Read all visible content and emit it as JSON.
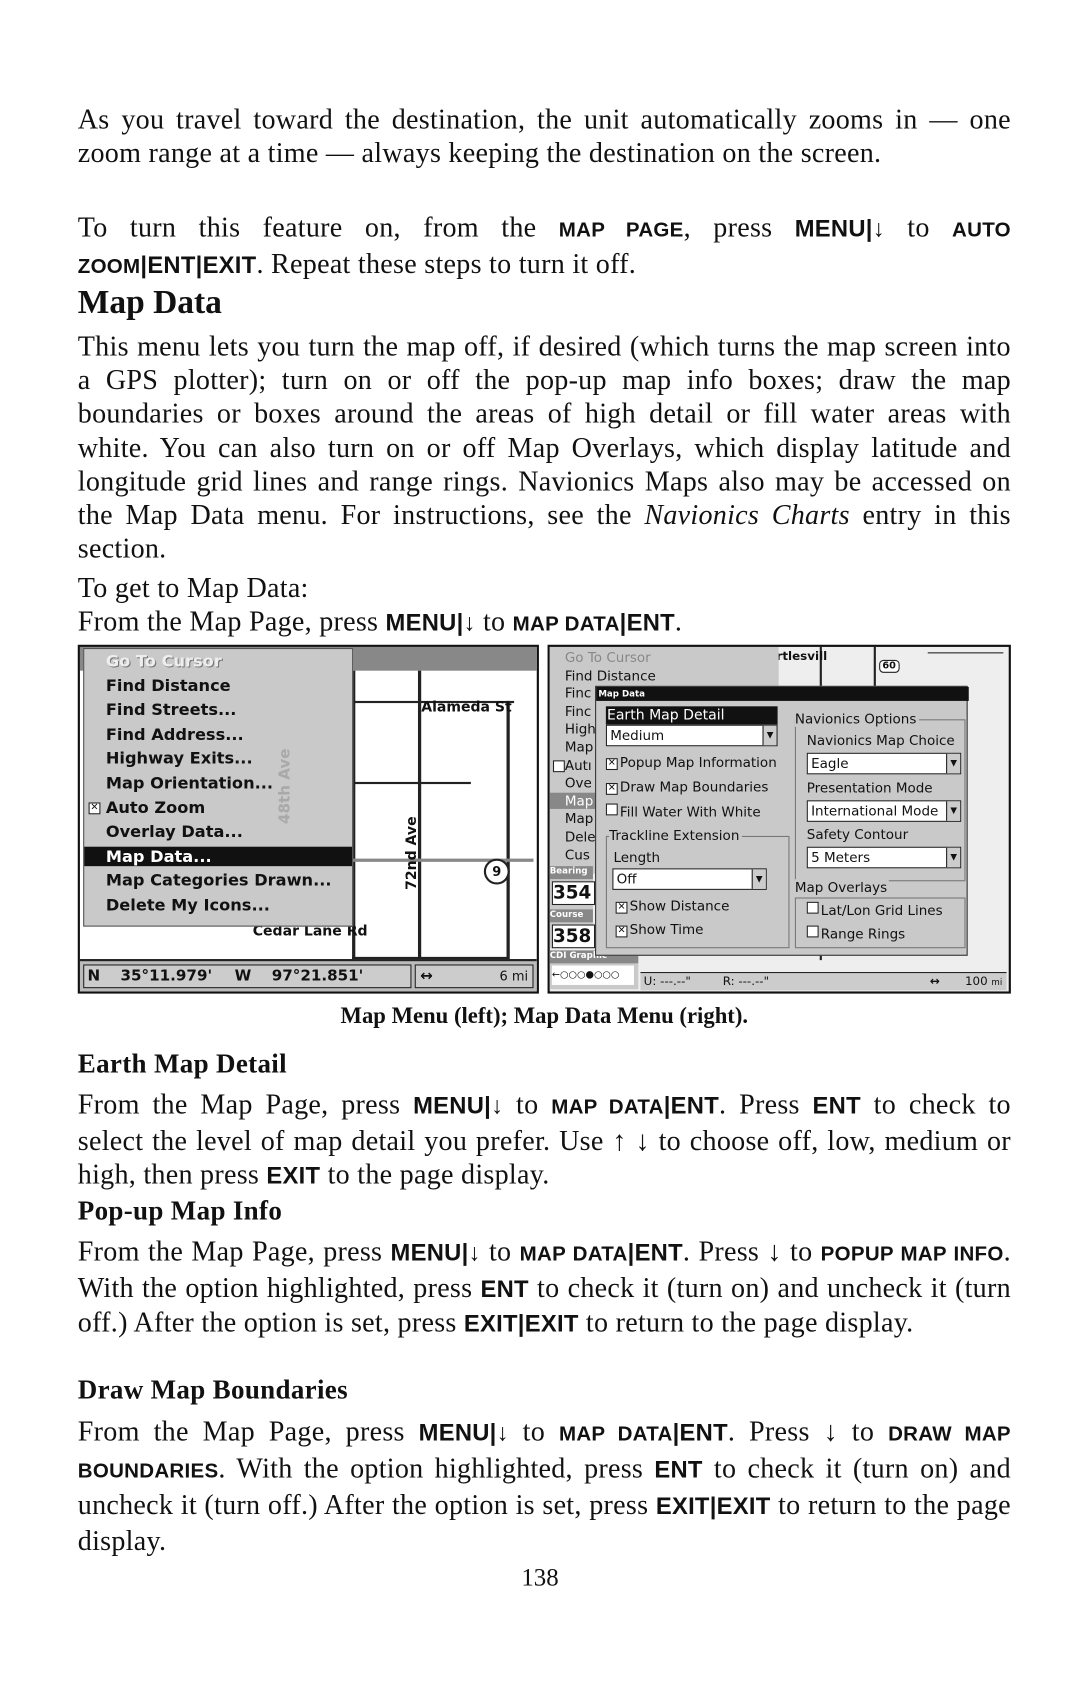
{
  "paragraphs": {
    "p1": [
      {
        "t": "As you travel toward the destination, the unit automatically zooms in — one zoom range at a time — always keeping the destination on the screen."
      }
    ],
    "p2": [
      {
        "t": "To turn this feature on, from the "
      },
      {
        "t": "Map Page",
        "s": "sc"
      },
      {
        "t": ", press "
      },
      {
        "t": "MENU",
        "s": "key"
      },
      {
        "t": "|",
        "s": "key"
      },
      {
        "t": "↓",
        "s": "key"
      },
      {
        "t": " to "
      },
      {
        "t": "Auto Zoom",
        "s": "sc"
      },
      {
        "t": "|",
        "s": "key"
      },
      {
        "t": "ENT",
        "s": "key"
      },
      {
        "t": "|",
        "s": "key"
      },
      {
        "t": "EXIT",
        "s": "key"
      },
      {
        "t": ". Repeat these steps to turn it off."
      }
    ],
    "p3": [
      {
        "t": "This menu lets you turn the map off, if desired (which turns the map screen into a GPS plotter); turn on or off the pop-up map info boxes; draw the map boundaries or boxes around the areas of high detail or fill water areas with white. You can also turn on or off Map Overlays, which display latitude and longitude grid lines and range rings. Navionics Maps also may be accessed on the Map Data menu. For instructions, see the "
      },
      {
        "t": "Navionics Charts",
        "s": "i"
      },
      {
        "t": " entry in this section."
      }
    ],
    "p4": [
      {
        "t": "To get to Map Data:"
      }
    ],
    "p5": [
      {
        "t": "From the Map Page, press "
      },
      {
        "t": "MENU",
        "s": "key"
      },
      {
        "t": "|",
        "s": "key"
      },
      {
        "t": "↓",
        "s": "key"
      },
      {
        "t": " to "
      },
      {
        "t": "Map Data",
        "s": "sc"
      },
      {
        "t": "|",
        "s": "key"
      },
      {
        "t": "ENT",
        "s": "key"
      },
      {
        "t": "."
      }
    ],
    "p6": [
      {
        "t": "From the Map Page, press "
      },
      {
        "t": "MENU",
        "s": "key"
      },
      {
        "t": "|",
        "s": "key"
      },
      {
        "t": "↓",
        "s": "key"
      },
      {
        "t": " to "
      },
      {
        "t": "Map Data",
        "s": "sc"
      },
      {
        "t": "|",
        "s": "key"
      },
      {
        "t": "ENT",
        "s": "key"
      },
      {
        "t": ". Press "
      },
      {
        "t": "ENT",
        "s": "key"
      },
      {
        "t": " to check to select the level of map detail you prefer. Use ↑ ↓ to choose off, low, medium  or high, then press "
      },
      {
        "t": "EXIT",
        "s": "key"
      },
      {
        "t": " to the page display."
      }
    ],
    "p7": [
      {
        "t": "From the Map Page, press "
      },
      {
        "t": "MENU",
        "s": "key"
      },
      {
        "t": "|",
        "s": "key"
      },
      {
        "t": "↓",
        "s": "key"
      },
      {
        "t": " to "
      },
      {
        "t": "Map Data",
        "s": "sc"
      },
      {
        "t": "|",
        "s": "key"
      },
      {
        "t": "ENT",
        "s": "key"
      },
      {
        "t": ". Press ↓ to "
      },
      {
        "t": "Popup Map Info",
        "s": "sc"
      },
      {
        "t": ". With the option highlighted, press "
      },
      {
        "t": "ENT",
        "s": "key"
      },
      {
        "t": " to check it (turn on) and uncheck it (turn off.) After the option is set, press "
      },
      {
        "t": "EXIT",
        "s": "key"
      },
      {
        "t": "|",
        "s": "key"
      },
      {
        "t": "EXIT",
        "s": "key"
      },
      {
        "t": " to return to the page display."
      }
    ],
    "p8": [
      {
        "t": "From the Map Page, press "
      },
      {
        "t": "MENU",
        "s": "key"
      },
      {
        "t": "|",
        "s": "key"
      },
      {
        "t": "↓",
        "s": "key"
      },
      {
        "t": " to "
      },
      {
        "t": "Map Data",
        "s": "sc"
      },
      {
        "t": "|",
        "s": "key"
      },
      {
        "t": "ENT",
        "s": "key"
      },
      {
        "t": ". Press ↓ to "
      },
      {
        "t": "Draw Map Boundaries",
        "s": "sc"
      },
      {
        "t": ". With the option highlighted, press "
      },
      {
        "t": "ENT",
        "s": "key"
      },
      {
        "t": " to check it (turn on) and uncheck it (turn off.) After the option is set, press "
      },
      {
        "t": "EXIT",
        "s": "key"
      },
      {
        "t": "|",
        "s": "key"
      },
      {
        "t": "EXIT",
        "s": "key"
      },
      {
        "t": " to return to the page display."
      }
    ]
  },
  "headings": {
    "map_data": "Map Data",
    "earth_map_detail": "Earth Map Detail",
    "popup_map_info": "Pop-up Map Info",
    "draw_map_boundaries": "Draw Map Boundaries"
  },
  "caption": "Map Menu (left); Map Data Menu (right).",
  "page_number": "138",
  "left_screen": {
    "menu_items": [
      {
        "label": "Go To Cursor",
        "state": "disabled"
      },
      {
        "label": "Find Distance"
      },
      {
        "label": "Find Streets..."
      },
      {
        "label": "Find Address..."
      },
      {
        "label": "Highway Exits..."
      },
      {
        "label": "Map Orientation..."
      },
      {
        "label": "Auto Zoom",
        "checked": true
      },
      {
        "label": "Overlay Data..."
      },
      {
        "label": "Map Data...",
        "state": "selected"
      },
      {
        "label": "Map Categories Drawn..."
      },
      {
        "label": "Delete My Icons..."
      }
    ],
    "map_labels": {
      "street1": "Alameda St",
      "street2": "72nd Ave",
      "street3": "Cedar Lane Rd",
      "street4": "48th Ave",
      "route": "9"
    },
    "status": {
      "lat_prefix": "N",
      "lat": "35°11.979'",
      "lon_prefix": "W",
      "lon": "97°21.851'",
      "zoom_icon": "↔",
      "range": "6 mi"
    }
  },
  "right_screen": {
    "background_menu": [
      "Go To Cursor",
      "Find Distance",
      "Finc",
      "Finc",
      "High",
      "Map",
      "Autı",
      "Ove",
      "Map",
      "Map",
      "Dele",
      "Cus"
    ],
    "map_labels": {
      "town": "rtlesvill",
      "highway": "60"
    },
    "bearing": {
      "label": "Bearing",
      "value": "354"
    },
    "course": {
      "label": "Course",
      "value": "358"
    },
    "cdi": {
      "label": "CDI Graphic",
      "value": "←○○○●○○○"
    },
    "status": {
      "u": "U:  ---.--\"",
      "r": "R:  ---.--\"",
      "zoom_icon": "↔",
      "range": "100",
      "unit": "mi"
    },
    "dialog": {
      "title": "Map Data",
      "earth_map_detail": {
        "label": "Earth Map Detail",
        "value": "Medium"
      },
      "popup_map_information": {
        "label": "Popup Map Information",
        "checked": true
      },
      "draw_map_boundaries": {
        "label": "Draw Map Boundaries",
        "checked": true
      },
      "fill_water_with_white": {
        "label": "Fill Water With White",
        "checked": false
      },
      "trackline": {
        "group": "Trackline Extension",
        "length_label": "Length",
        "length_value": "Off",
        "show_distance": {
          "label": "Show Distance",
          "checked": true
        },
        "show_time": {
          "label": "Show Time",
          "checked": true
        }
      },
      "navionics": {
        "group": "Navionics Options",
        "map_choice_label": "Navionics Map Choice",
        "map_choice": "Eagle",
        "presentation_label": "Presentation Mode",
        "presentation": "International Mode",
        "safety_label": "Safety Contour",
        "safety": "5 Meters"
      },
      "overlays": {
        "group": "Map Overlays",
        "latlon": {
          "label": "Lat/Lon Grid Lines",
          "checked": false
        },
        "range_rings": {
          "label": "Range Rings",
          "checked": false
        }
      }
    }
  }
}
